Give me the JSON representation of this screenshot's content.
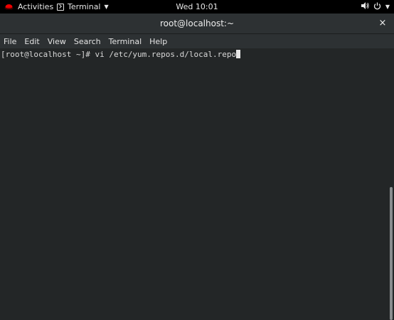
{
  "topbar": {
    "activities": "Activities",
    "app_menu": "Terminal",
    "clock": "Wed 10:01",
    "icons": [
      "redhat-icon",
      "terminal-icon",
      "volume-icon",
      "power-icon"
    ]
  },
  "window": {
    "title": "root@localhost:~",
    "close": "×"
  },
  "menubar": {
    "items": [
      "File",
      "Edit",
      "View",
      "Search",
      "Terminal",
      "Help"
    ]
  },
  "terminal": {
    "prompt": "[root@localhost ~]# ",
    "command": "vi /etc/yum.repos.d/local.repo"
  },
  "scrollbar": {
    "position_fraction": 0.51
  }
}
